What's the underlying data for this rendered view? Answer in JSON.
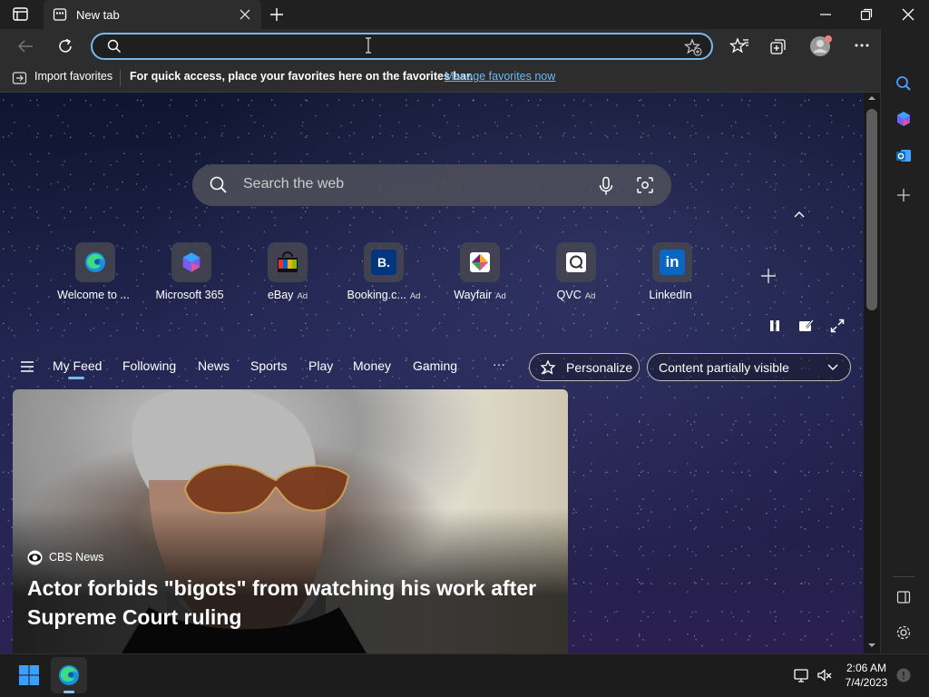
{
  "tab": {
    "title": "New tab"
  },
  "address_bar": {
    "value": ""
  },
  "favorites_bar": {
    "import_label": "Import favorites",
    "message": "For quick access, place your favorites here on the favorites bar.",
    "manage_link": "Manage favorites now"
  },
  "search": {
    "placeholder": "Search the web"
  },
  "quick_links": [
    {
      "label": "Welcome to ...",
      "ad": "",
      "icon": "edge-icon"
    },
    {
      "label": "Microsoft 365",
      "ad": "",
      "icon": "m365-icon"
    },
    {
      "label": "eBay",
      "ad": "Ad",
      "icon": "ebay-icon"
    },
    {
      "label": "Booking.c...",
      "ad": "Ad",
      "icon": "booking-icon"
    },
    {
      "label": "Wayfair",
      "ad": "Ad",
      "icon": "wayfair-icon"
    },
    {
      "label": "QVC",
      "ad": "Ad",
      "icon": "qvc-icon"
    },
    {
      "label": "LinkedIn",
      "ad": "",
      "icon": "linkedin-icon"
    }
  ],
  "booking_glyph": "B.",
  "linkedin_glyph": "in",
  "feed_nav": {
    "items": [
      "My Feed",
      "Following",
      "News",
      "Sports",
      "Play",
      "Money",
      "Gaming"
    ],
    "more": "···",
    "personalize": "Personalize",
    "content_visibility": "Content partially visible"
  },
  "card": {
    "source": "CBS News",
    "title": "Actor forbids \"bigots\" from watching his work after Supreme Court ruling"
  },
  "taskbar": {
    "time": "2:06 AM",
    "date": "7/4/2023"
  },
  "colors": {
    "accent": "#76b9ed",
    "link": "#6cb8f5",
    "background": "#202020"
  }
}
